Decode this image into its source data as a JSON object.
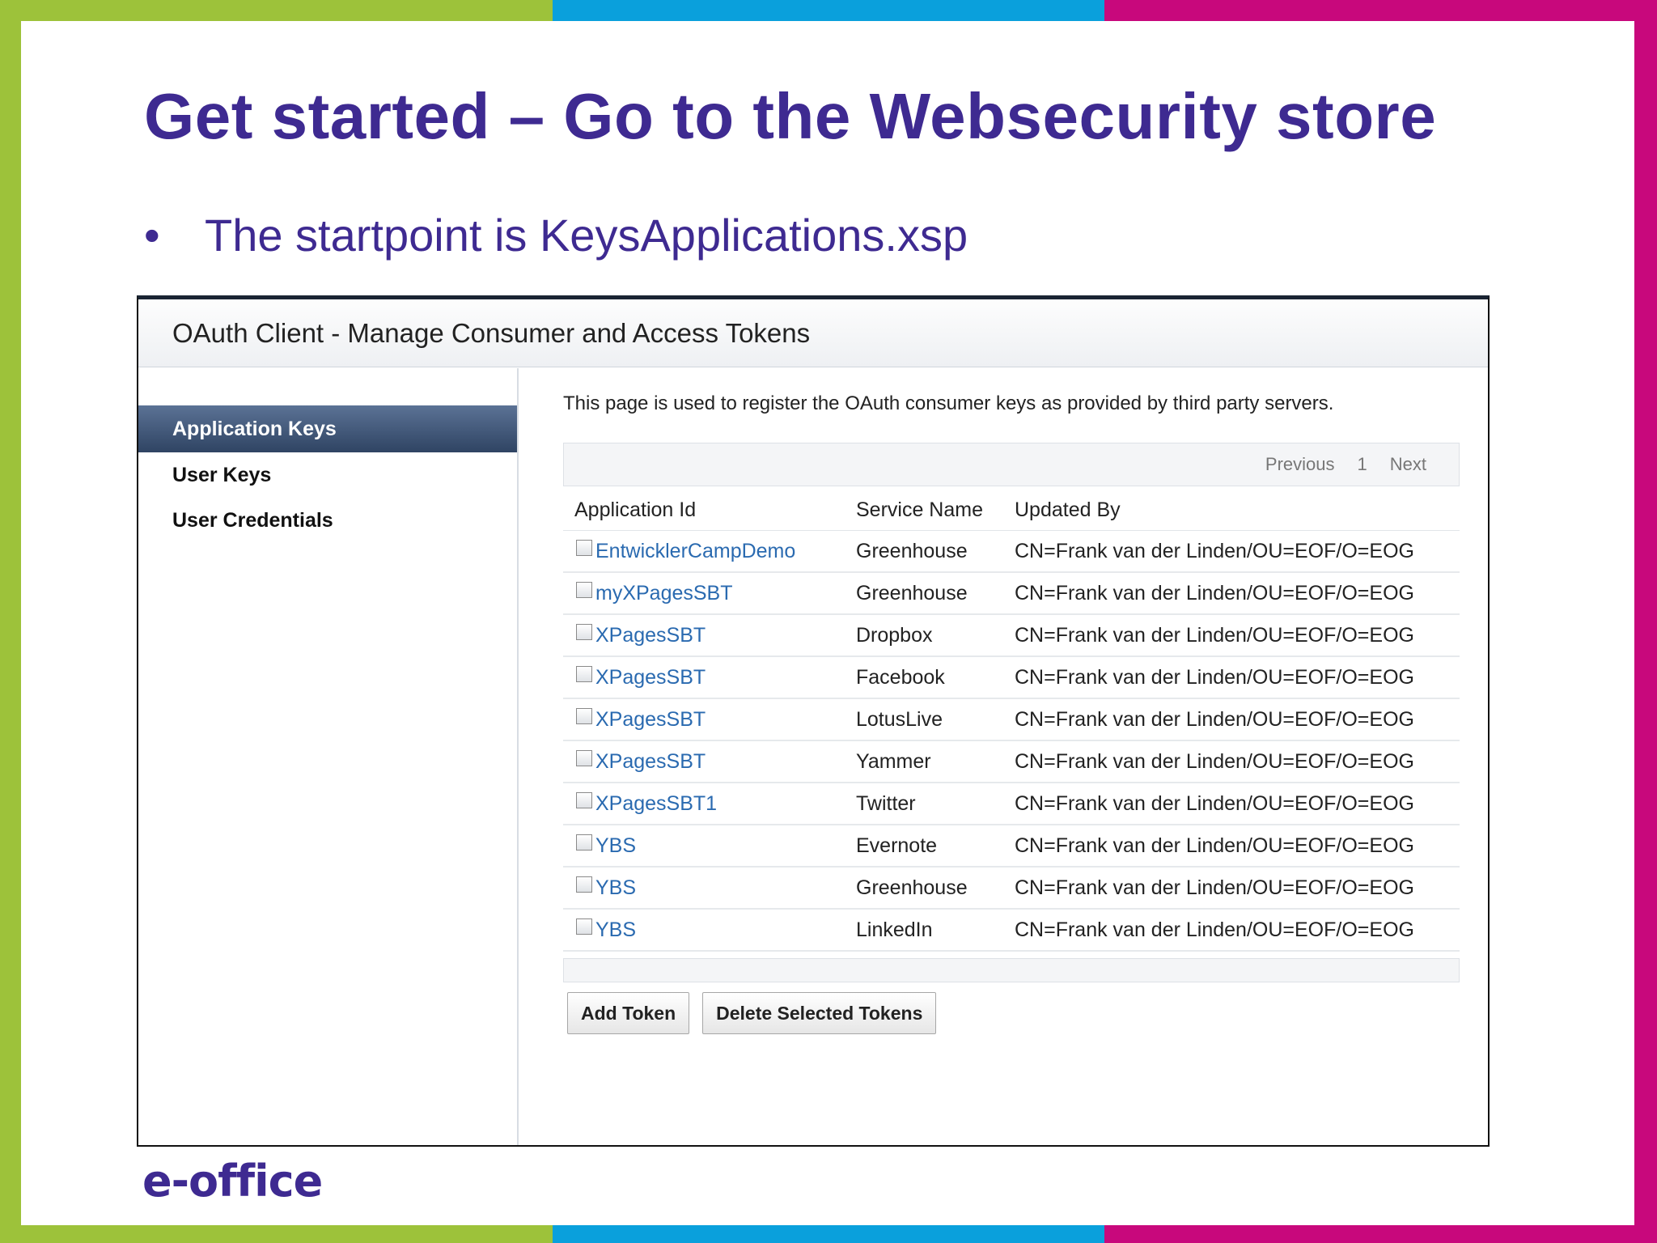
{
  "slide": {
    "title": "Get started – Go to the Websecurity store",
    "bullet": "•",
    "bullet_text": "The startpoint is KeysApplications.xsp",
    "logo_text": "e-office"
  },
  "app": {
    "header_title": "OAuth Client - Manage Consumer and Access Tokens",
    "sidebar": {
      "items": [
        {
          "label": "Application Keys"
        },
        {
          "label": "User Keys"
        },
        {
          "label": "User Credentials"
        }
      ]
    },
    "description": "This page is used to register the OAuth consumer keys as provided by third party servers.",
    "pager": {
      "previous": "Previous",
      "page": "1",
      "next": "Next"
    },
    "table": {
      "headers": {
        "app_id": "Application Id",
        "service": "Service Name",
        "updated_by": "Updated By"
      },
      "rows": [
        {
          "app_id": "EntwicklerCampDemo",
          "service": "Greenhouse",
          "updated_by": "CN=Frank van der Linden/OU=EOF/O=EOG"
        },
        {
          "app_id": "myXPagesSBT",
          "service": "Greenhouse",
          "updated_by": "CN=Frank van der Linden/OU=EOF/O=EOG"
        },
        {
          "app_id": "XPagesSBT",
          "service": "Dropbox",
          "updated_by": "CN=Frank van der Linden/OU=EOF/O=EOG"
        },
        {
          "app_id": "XPagesSBT",
          "service": "Facebook",
          "updated_by": "CN=Frank van der Linden/OU=EOF/O=EOG"
        },
        {
          "app_id": "XPagesSBT",
          "service": "LotusLive",
          "updated_by": "CN=Frank van der Linden/OU=EOF/O=EOG"
        },
        {
          "app_id": "XPagesSBT",
          "service": "Yammer",
          "updated_by": "CN=Frank van der Linden/OU=EOF/O=EOG"
        },
        {
          "app_id": "XPagesSBT1",
          "service": "Twitter",
          "updated_by": "CN=Frank van der Linden/OU=EOF/O=EOG"
        },
        {
          "app_id": "YBS",
          "service": "Evernote",
          "updated_by": "CN=Frank van der Linden/OU=EOF/O=EOG"
        },
        {
          "app_id": "YBS",
          "service": "Greenhouse",
          "updated_by": "CN=Frank van der Linden/OU=EOF/O=EOG"
        },
        {
          "app_id": "YBS",
          "service": "LinkedIn",
          "updated_by": "CN=Frank van der Linden/OU=EOF/O=EOG"
        }
      ]
    },
    "buttons": {
      "add": "Add Token",
      "delete": "Delete Selected Tokens"
    }
  },
  "colors": {
    "title": "#3e2a91",
    "frame_green": "#9dc23a",
    "frame_blue": "#0aa0dc",
    "frame_magenta": "#c8087c",
    "link": "#2a6ab0"
  }
}
